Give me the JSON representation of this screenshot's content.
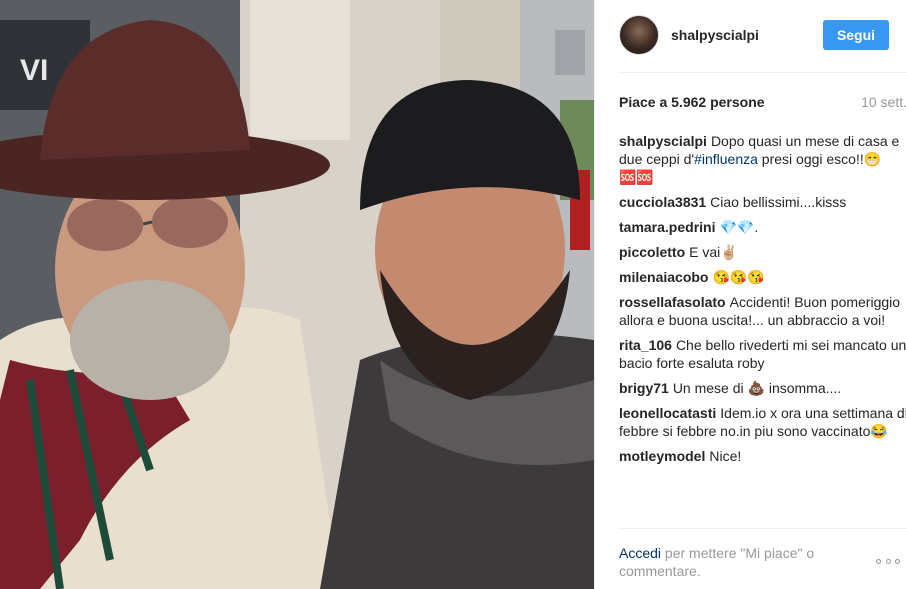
{
  "post": {
    "username": "shalpyscialpi",
    "follow_label": "Segui",
    "likes": "Piace a 5.962 persone",
    "date": "10 sett."
  },
  "caption": {
    "user": "shalpyscialpi",
    "text_before": "Dopo quasi un mese di casa e due ceppi d'",
    "hashtag": "#influenza",
    "text_after": " presi oggi esco!!😁🆘🆘"
  },
  "comments": [
    {
      "user": "cucciola3831",
      "text": "Ciao bellissimi....kisss"
    },
    {
      "user": "tamara.pedrini",
      "text": "💎💎."
    },
    {
      "user": "piccoletto",
      "text": "E vai✌🏼"
    },
    {
      "user": "milenaiacobo",
      "text": "😘😘😘"
    },
    {
      "user": "rossellafasolato",
      "text": "Accidenti! Buon pomeriggio allora e buona uscita!... un abbraccio a voi!"
    },
    {
      "user": "rita_106",
      "text": "Che bello rivederti mi sei mancato un bacio forte esaluta roby"
    },
    {
      "user": "brigy71",
      "text": "Un mese di 💩 insomma...."
    },
    {
      "user": "leonellocatasti",
      "text": "Idem.io x ora una settimana di febbre si febbre no.in piu sono vaccinato😂"
    },
    {
      "user": "motleymodel",
      "text": "Nice!"
    }
  ],
  "footer": {
    "login_label": "Accedi",
    "rest": " per mettere \"Mi piace\" o commentare."
  },
  "icons": {
    "more": "more-options-icon"
  },
  "colors": {
    "follow_button": "#3897f0",
    "link": "#003569",
    "muted": "#999999"
  }
}
